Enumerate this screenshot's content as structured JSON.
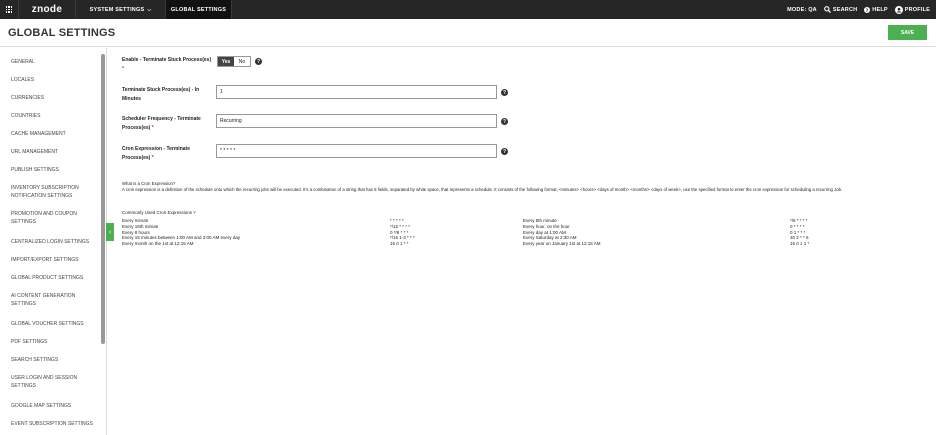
{
  "topbar": {
    "logo": "znode",
    "nav": [
      {
        "label": "SYSTEM SETTINGS",
        "has_dropdown": true
      },
      {
        "label": "GLOBAL SETTINGS",
        "active": true
      }
    ],
    "mode": "MODE: QA",
    "search": "SEARCH",
    "help": "HELP",
    "profile": "PROFILE"
  },
  "header": {
    "title": "GLOBAL SETTINGS",
    "save_label": "SAVE",
    "accent_color": "#4caf50"
  },
  "sidebar": {
    "items": [
      "GENERAL",
      "LOCALES",
      "CURRENCIES",
      "COUNTRIES",
      "CACHE MANAGEMENT",
      "URL MANAGEMENT",
      "PUBLISH SETTINGS",
      "INVENTORY SUBSCRIPTION NOTIFICATION SETTINGS",
      "PROMOTION AND COUPON SETTINGS",
      "CENTRALIZED LOGIN SETTINGS",
      "IMPORT/EXPORT SETTINGS",
      "GLOBAL PRODUCT SETTINGS",
      "AI CONTENT GENERATION SETTINGS",
      "GLOBAL VOUCHER SETTINGS",
      "PDF SETTINGS",
      "SEARCH SETTINGS",
      "USER LOGIN AND SESSION SETTINGS",
      "GOOGLE MAP SETTINGS",
      "EVENT SUBSCRIPTION SETTINGS"
    ]
  },
  "form": {
    "enable": {
      "label": "Enable - Terminate Stuck Process(es)",
      "required": "*",
      "yes": "Yes",
      "no": "No",
      "selected": "Yes"
    },
    "terminate_minutes": {
      "label": "Terminate Stuck Process(es) - In Minutes",
      "value": "1"
    },
    "scheduler_frequency": {
      "label": "Scheduler Frequency - Terminate Process(es)",
      "required": "*",
      "value": "Recurring"
    },
    "cron_expression": {
      "label": "Cron Expression - Terminate Process(es)",
      "required": "*",
      "value": "* * * * *"
    }
  },
  "cron_help": {
    "question": "What is a Cron Expression?",
    "description": "A cron expression is a definition of the schedule onto which the recurring jobs will be executed. It's a combination of a string that has 5 fields, separated by white space, that represents a schedule. It consists of the following format, <minutes> <hours> <days of month> <months> <days of week>, use the specified format to enter the cron expression for scheduling a recurring Job.",
    "common_heading": "Commonly Used Cron Expressions",
    "rows": [
      [
        "Every minute",
        "* * * * *",
        "Every 5th minute",
        "*/5 * * * *"
      ],
      [
        "Every 15th minute",
        "*/15 * * * *",
        "Every hour, on the hour",
        "0 * * * *"
      ],
      [
        "Every 8 hours",
        "0 */8 * * *",
        "Every day at 1:00 AM",
        "0 1 * * *"
      ],
      [
        "Every 15 minutes between 1:00 AM and 3:00 AM every day",
        "*/15 1-3 * * *",
        "Every Saturday at 2:30 AM",
        "30 2 * * 6"
      ],
      [
        "Every month on the 1st at 12:15 AM",
        "15 0 1 * *",
        "Every year on January 1st at 12:15 AM",
        "15 0 1 1 *"
      ]
    ]
  }
}
